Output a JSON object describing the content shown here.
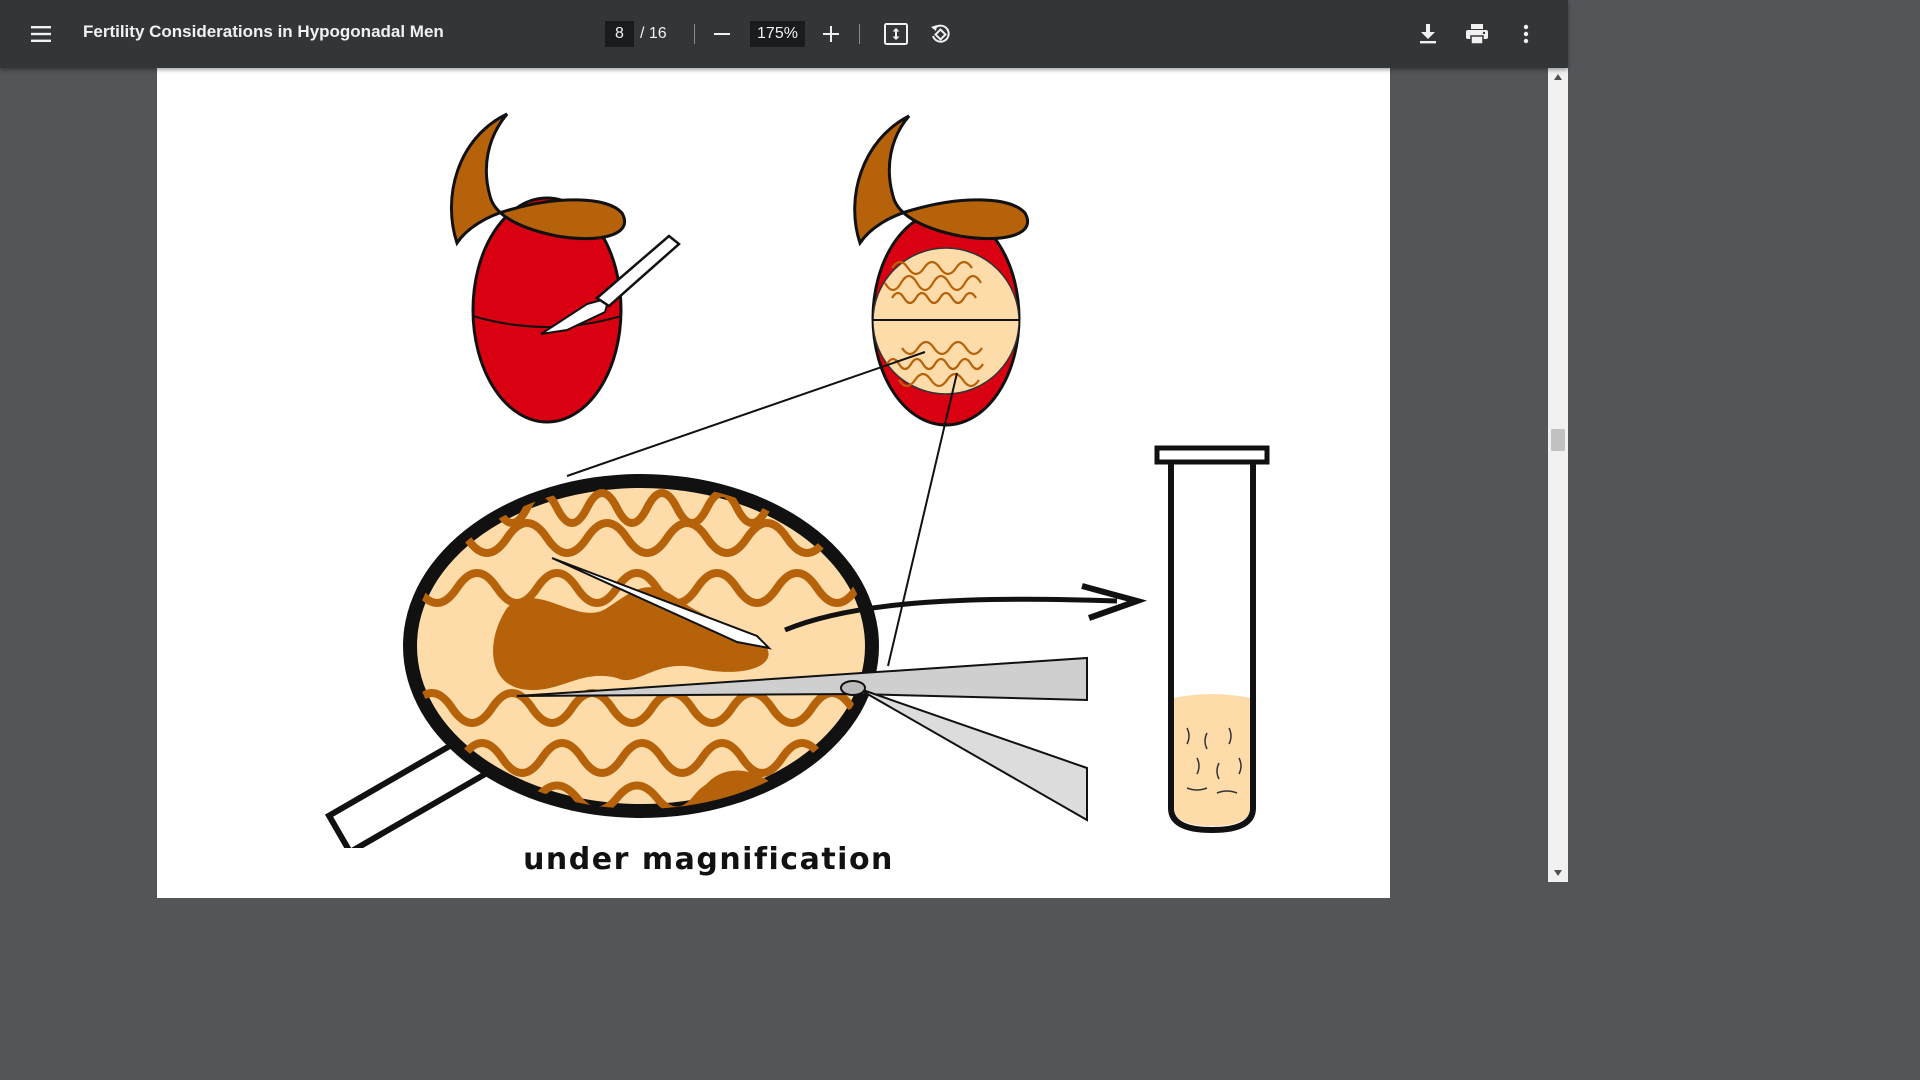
{
  "toolbar": {
    "menu_icon": "hamburger-menu-icon",
    "title": "Fertility Considerations in Hypogonadal Men",
    "current_page": "8",
    "page_total": "/ 16",
    "zoom": "175%",
    "icons": [
      "zoom-out-icon",
      "zoom-in-icon",
      "fit-page-icon",
      "rotate-icon",
      "download-icon",
      "print-icon",
      "more-vert-icon"
    ]
  },
  "document": {
    "figure_caption": "under magnification"
  },
  "colors": {
    "toolbar_bg": "#323639",
    "viewer_bg": "#525659",
    "testis_red": "#cc0000",
    "epididymis_brown": "#b5620a",
    "tissue_cream": "#fddcaa"
  }
}
